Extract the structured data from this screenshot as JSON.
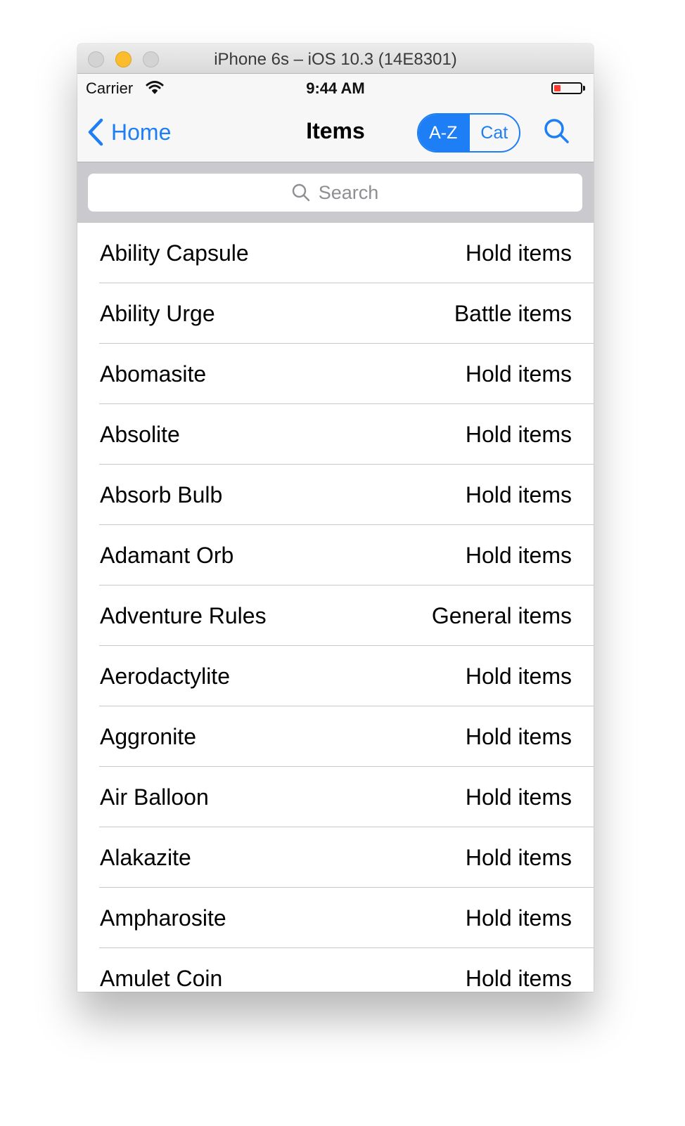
{
  "window": {
    "title": "iPhone 6s – iOS 10.3 (14E8301)"
  },
  "status_bar": {
    "carrier": "Carrier",
    "time": "9:44 AM",
    "battery_color": "#ff3b30"
  },
  "nav": {
    "back_label": "Home",
    "title": "Items",
    "segments": [
      "A-Z",
      "Cat"
    ],
    "selected_segment": "A-Z"
  },
  "search": {
    "placeholder": "Search"
  },
  "colors": {
    "accent": "#1d7ef5",
    "separator": "#c8c7cc",
    "search_bar_bg": "#c9c9ce"
  },
  "items": [
    {
      "name": "Ability Capsule",
      "category": "Hold items"
    },
    {
      "name": "Ability Urge",
      "category": "Battle items"
    },
    {
      "name": "Abomasite",
      "category": "Hold items"
    },
    {
      "name": "Absolite",
      "category": "Hold items"
    },
    {
      "name": "Absorb Bulb",
      "category": "Hold items"
    },
    {
      "name": "Adamant Orb",
      "category": "Hold items"
    },
    {
      "name": "Adventure Rules",
      "category": "General items"
    },
    {
      "name": "Aerodactylite",
      "category": "Hold items"
    },
    {
      "name": "Aggronite",
      "category": "Hold items"
    },
    {
      "name": "Air Balloon",
      "category": "Hold items"
    },
    {
      "name": "Alakazite",
      "category": "Hold items"
    },
    {
      "name": "Ampharosite",
      "category": "Hold items"
    },
    {
      "name": "Amulet Coin",
      "category": "Hold items"
    }
  ]
}
